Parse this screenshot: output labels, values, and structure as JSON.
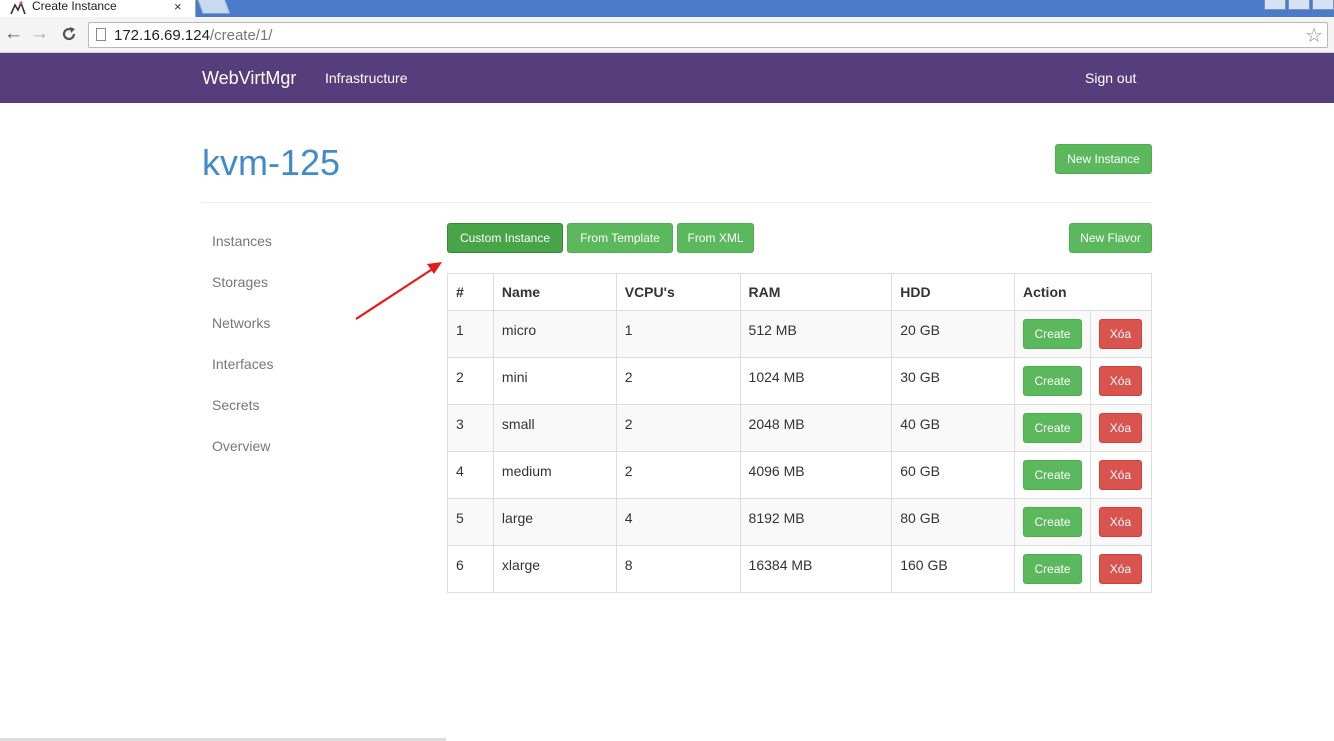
{
  "browser": {
    "tab_title": "Create Instance",
    "tab_close": "×",
    "url_host": "172.16.69.124",
    "url_path": "/create/1/"
  },
  "navbar": {
    "brand": "WebVirtMgr",
    "infrastructure": "Infrastructure",
    "sign_out": "Sign out",
    "bg_color": "#563d7c"
  },
  "page": {
    "title": "kvm-125",
    "new_instance": "New Instance"
  },
  "sidebar": {
    "items": [
      {
        "label": "Instances"
      },
      {
        "label": "Storages"
      },
      {
        "label": "Networks"
      },
      {
        "label": "Interfaces"
      },
      {
        "label": "Secrets"
      },
      {
        "label": "Overview"
      }
    ]
  },
  "tabs": {
    "custom_instance": "Custom Instance",
    "from_template": "From Template",
    "from_xml": "From XML",
    "new_flavor": "New Flavor"
  },
  "table": {
    "headers": [
      "#",
      "Name",
      "VCPU's",
      "RAM",
      "HDD",
      "Action"
    ],
    "rows": [
      {
        "id": "1",
        "name": "micro",
        "vcpu": "1",
        "ram": "512 MB",
        "hdd": "20 GB",
        "create": "Create",
        "delete": "Xóa"
      },
      {
        "id": "2",
        "name": "mini",
        "vcpu": "2",
        "ram": "1024 MB",
        "hdd": "30 GB",
        "create": "Create",
        "delete": "Xóa"
      },
      {
        "id": "3",
        "name": "small",
        "vcpu": "2",
        "ram": "2048 MB",
        "hdd": "40 GB",
        "create": "Create",
        "delete": "Xóa"
      },
      {
        "id": "4",
        "name": "medium",
        "vcpu": "2",
        "ram": "4096 MB",
        "hdd": "60 GB",
        "create": "Create",
        "delete": "Xóa"
      },
      {
        "id": "5",
        "name": "large",
        "vcpu": "4",
        "ram": "8192 MB",
        "hdd": "80 GB",
        "create": "Create",
        "delete": "Xóa"
      },
      {
        "id": "6",
        "name": "xlarge",
        "vcpu": "8",
        "ram": "16384 MB",
        "hdd": "160 GB",
        "create": "Create",
        "delete": "Xóa"
      }
    ]
  },
  "colors": {
    "success": "#5cb85c",
    "danger": "#d9534f",
    "title": "#428bca",
    "annotation_arrow": "#e31b1b"
  },
  "icons": {
    "back": "arrow-left-icon",
    "forward": "arrow-right-icon",
    "reload": "reload-icon",
    "bookmark": "star-icon",
    "page": "page-icon",
    "annotation": "red-arrow-icon"
  }
}
